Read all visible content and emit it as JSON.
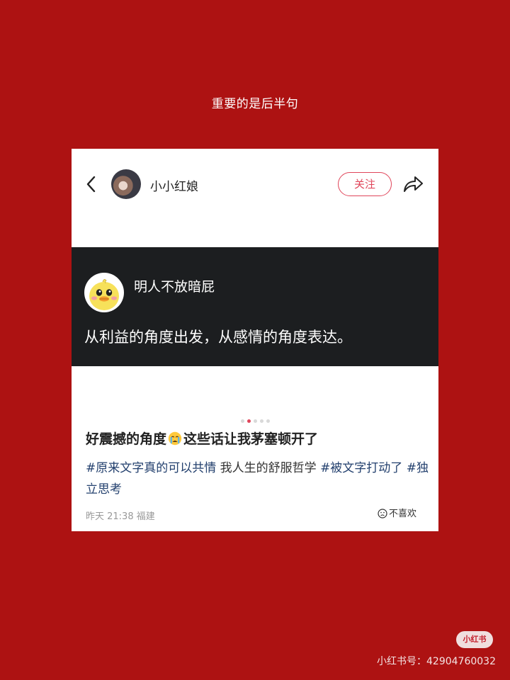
{
  "caption": "重要的是后半句",
  "post": {
    "username": "小小红娘",
    "follow_label": "关注",
    "quote": {
      "author": "明人不放暗屁",
      "text": "从利益的角度出发，从感情的角度表达。"
    },
    "pager": {
      "total": 5,
      "active": 2
    },
    "title_before": "好震撼的角度",
    "title_emoji": "crying-emoji",
    "title_after": "这些话让我茅塞顿开了",
    "tags": {
      "tag1": "#原来文字真的可以共情",
      "plain": " 我人生的舒服哲学 ",
      "tag2": "#被文字打动了",
      "tag3": "#独立思考"
    },
    "meta": "昨天 21:38 福建",
    "dislike_label": "不喜欢"
  },
  "watermark": {
    "logo": "小红书",
    "text": "小红书号：42904760032"
  },
  "colors": {
    "background": "#ad1212",
    "accent": "#e0455a",
    "tag": "#23406e",
    "quote_bg": "#1c1e20"
  }
}
